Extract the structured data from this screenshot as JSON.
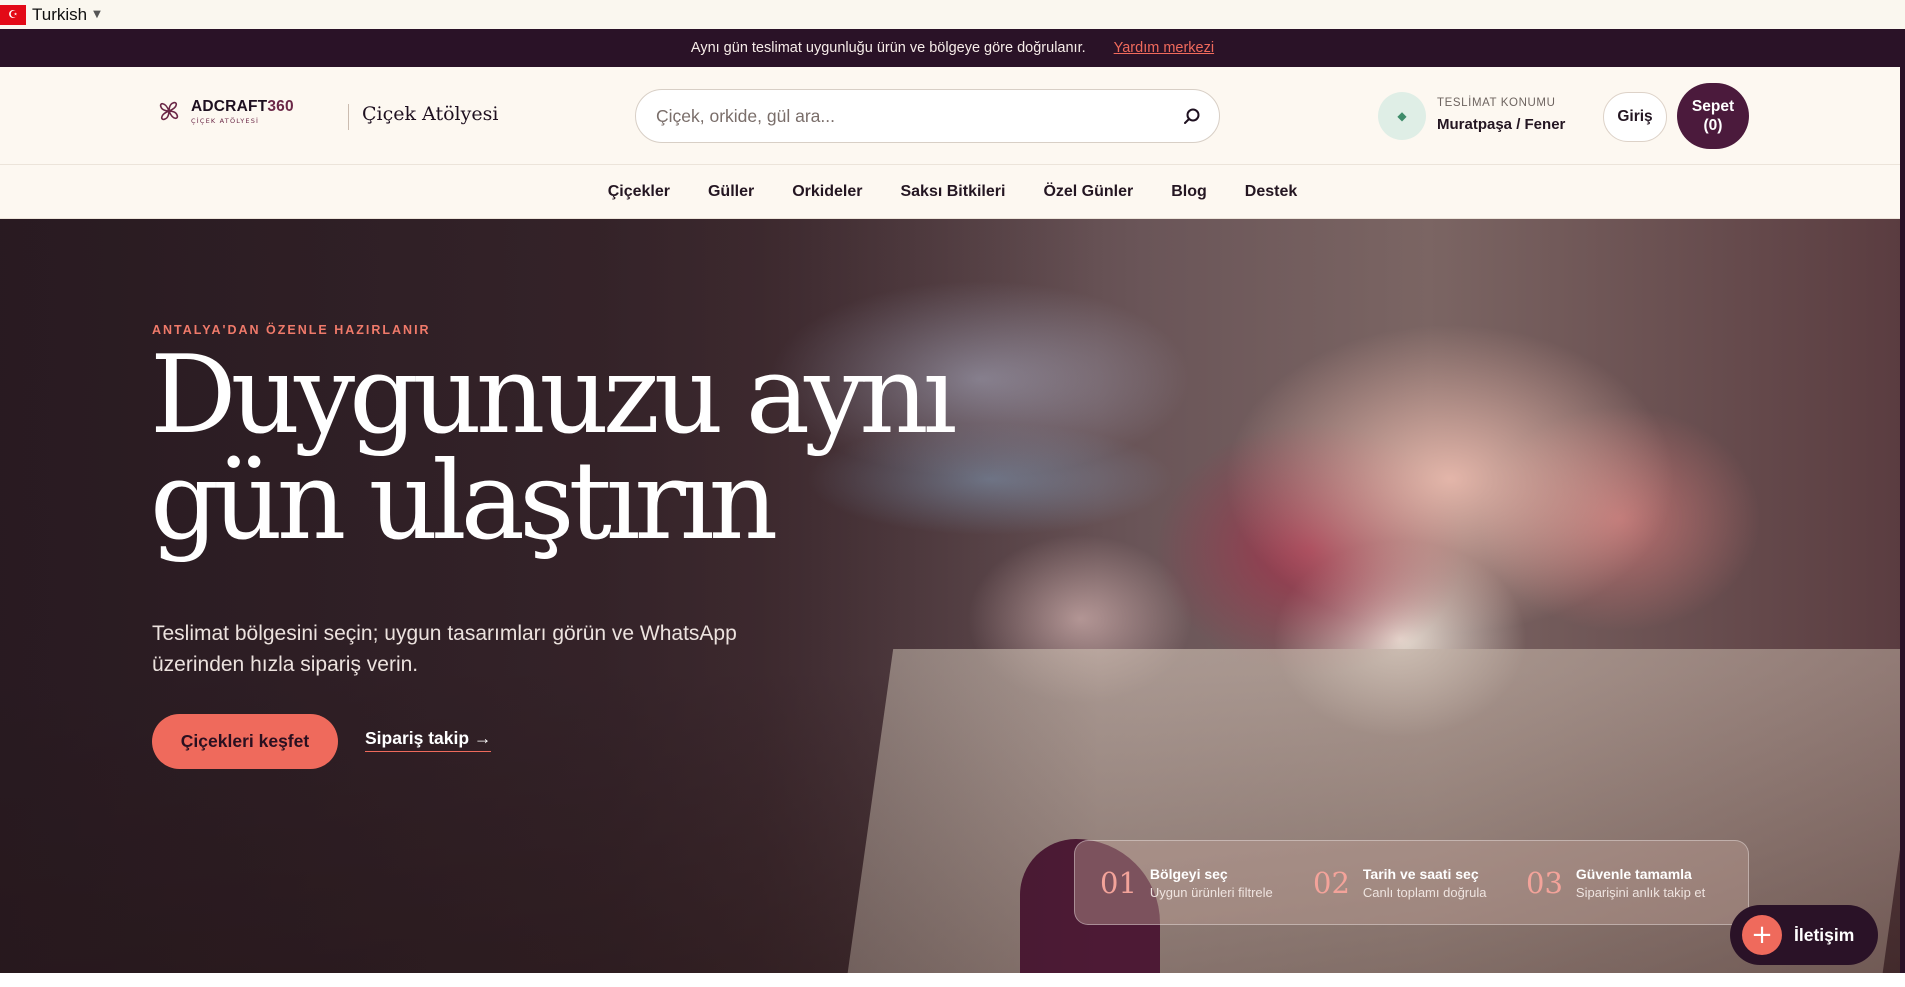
{
  "language_bar": {
    "language": "Turkish",
    "flag_glyph": "☪"
  },
  "announcement": {
    "message": "Aynı gün teslimat uygunluğu ürün ve bölgeye göre doğrulanır.",
    "link": "Yardım merkezi"
  },
  "header": {
    "brand": "ADCRAFT",
    "brand_number": "360",
    "brand_sub": "ÇİÇEK ATÖLYESİ",
    "studio": "Çiçek Atölyesi",
    "search_placeholder": "Çiçek, orkide, gül ara...",
    "delivery_label": "TESLİMAT KONUMU",
    "delivery_value": "Muratpaşa / Fener",
    "login": "Giriş",
    "cart_label": "Sepet",
    "cart_count": "(0)"
  },
  "nav": {
    "items": [
      "Çiçekler",
      "Güller",
      "Orkideler",
      "Saksı Bitkileri",
      "Özel Günler",
      "Blog",
      "Destek"
    ]
  },
  "hero": {
    "eyebrow": "ANTALYA'DAN ÖZENLE HAZIRLANIR",
    "title_line1": "Duygunuzu aynı",
    "title_line2": "gün ulaştırın",
    "subtitle": "Teslimat bölgesini seçin; uygun tasarımları görün ve WhatsApp üzerinden hızla sipariş verin.",
    "primary_cta": "Çiçekleri keşfet",
    "secondary_cta": "Sipariş takip →"
  },
  "steps": [
    {
      "num": "01",
      "title": "Bölgeyi seç",
      "desc": "Uygun ürünleri filtrele"
    },
    {
      "num": "02",
      "title": "Tarih ve saati seç",
      "desc": "Canlı toplamı doğrula"
    },
    {
      "num": "03",
      "title": "Güvenle tamamla",
      "desc": "Siparişini anlık takip et"
    }
  ],
  "contact": {
    "label": "İletişim",
    "plus": "+"
  },
  "colors": {
    "accent": "#ef6a5c",
    "plum": "#4b1a3c",
    "dark": "#2a1227",
    "cream": "#fdf8f1"
  }
}
